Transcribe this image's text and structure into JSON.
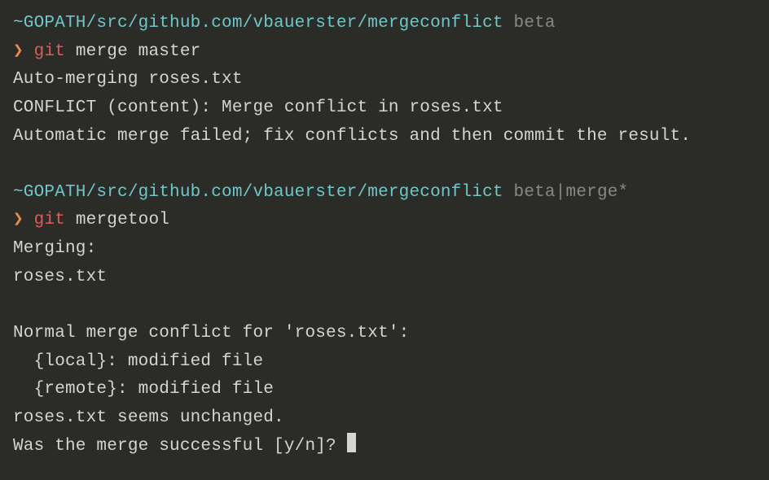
{
  "block1": {
    "prompt_path": "~GOPATH/src/github.com/vbauerster/mergeconflict",
    "branch": "beta",
    "cmd_prefix": "❯ ",
    "cmd_git": "git",
    "cmd_rest": " merge master",
    "out1": "Auto-merging roses.txt",
    "out2": "CONFLICT (content): Merge conflict in roses.txt",
    "out3": "Automatic merge failed; fix conflicts and then commit the result."
  },
  "block2": {
    "prompt_path": "~GOPATH/src/github.com/vbauerster/mergeconflict",
    "branch": "beta",
    "merge_suffix": "|merge*",
    "cmd_prefix": "❯ ",
    "cmd_git": "git",
    "cmd_rest": " mergetool",
    "out1": "Merging:",
    "out2": "roses.txt",
    "out3": "Normal merge conflict for 'roses.txt':",
    "out4": "  {local}: modified file",
    "out5": "  {remote}: modified file",
    "out6": "roses.txt seems unchanged.",
    "out7": "Was the merge successful [y/n]? "
  }
}
